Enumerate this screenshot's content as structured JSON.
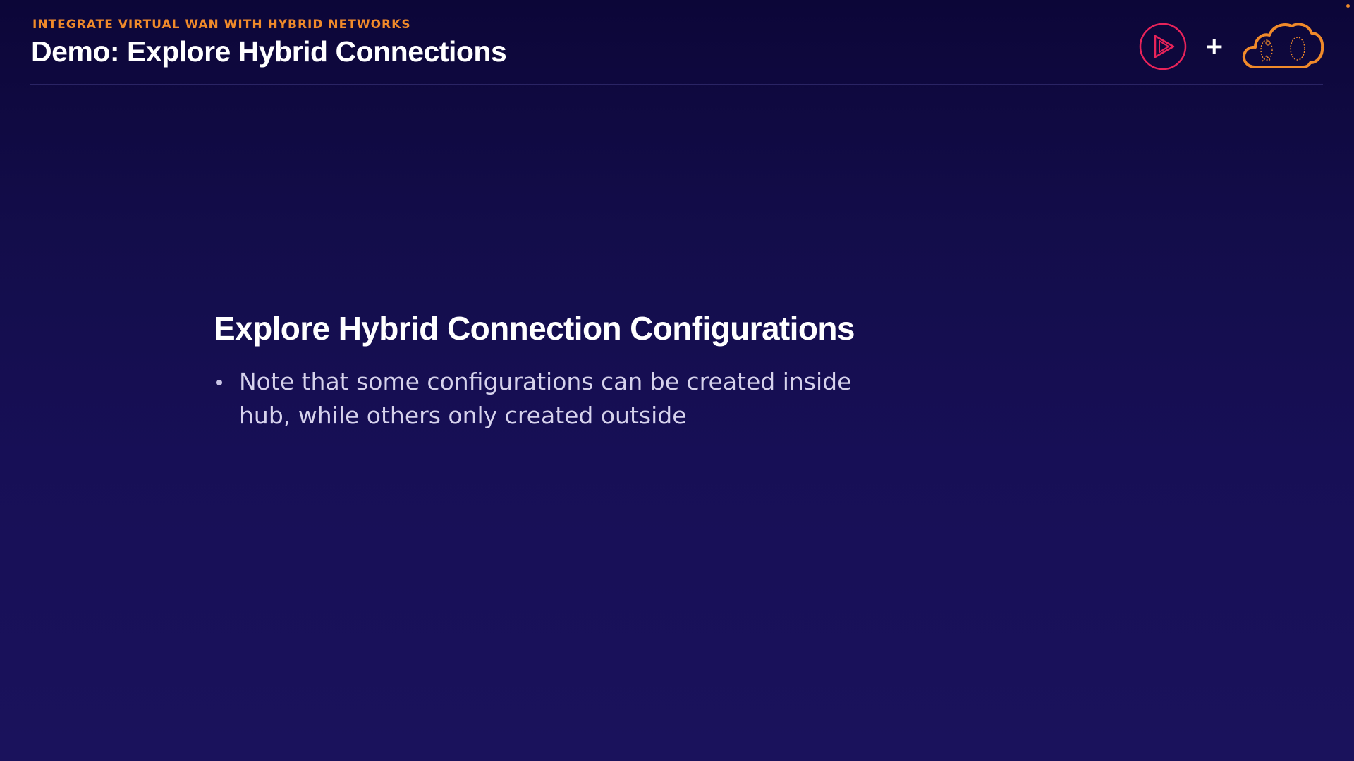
{
  "header": {
    "eyebrow": "INTEGRATE VIRTUAL WAN WITH HYBRID NETWORKS",
    "title": "Demo: Explore Hybrid Connections"
  },
  "logos": {
    "left_icon": "play-circle-logo-icon",
    "separator": "+",
    "right_icon": "cloud-logo-icon"
  },
  "content": {
    "heading": "Explore Hybrid Connection Configurations",
    "bullets": [
      {
        "text": "Note that some configurations can be created inside hub, while others only created outside"
      }
    ]
  },
  "colors": {
    "background_top": "#0c0638",
    "background_bottom": "#1a125c",
    "accent_orange": "#f08a2a",
    "play_logo_pink": "#e8235a",
    "text_white": "#ffffff",
    "bullet_text": "#d6d2ec"
  }
}
